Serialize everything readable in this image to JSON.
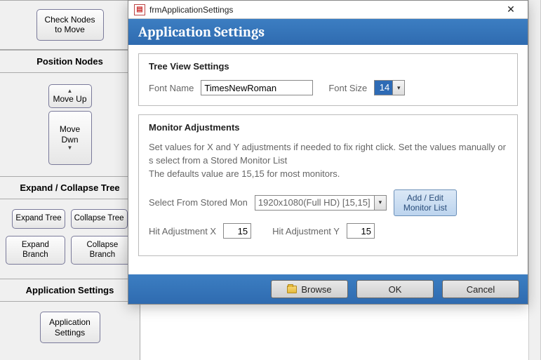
{
  "leftPanel": {
    "checkNodes": "Check Nodes\nto Move",
    "positionHeader": "Position Nodes",
    "moveUp": "Move Up",
    "moveDn": "Move\nDwn",
    "expandHeader": "Expand / Collapse Tree",
    "expandTree": "Expand Tree",
    "collapseTree": "Collapse Tree",
    "expandBranch": "Expand Branch",
    "collapseBranch": "Collapse Branch",
    "appSettingsHeader": "Application Settings",
    "appSettingsBtn": "Application\nSettings"
  },
  "dialog": {
    "formName": "frmApplicationSettings",
    "bannerTitle": "Application Settings",
    "treeView": {
      "title": "Tree View Settings",
      "fontNameLabel": "Font Name",
      "fontNameValue": "TimesNewRoman",
      "fontSizeLabel": "Font Size",
      "fontSizeValue": "14"
    },
    "monitor": {
      "title": "Monitor Adjustments",
      "help": "Set  values for X and Y adjustments if needed to fix right click.   Set the values manually or s select from a Stored Monitor List\nThe defaults value are 15,15 for most monitors.",
      "selectLabel": "Select From Stored Mon",
      "selectValue": "1920x1080(Full HD) [15,15]",
      "addEdit": "Add / Edit\nMonitor List",
      "hitXLabel": "Hit Adjustment X",
      "hitXValue": "15",
      "hitYLabel": "Hit Adjustment Y",
      "hitYValue": "15"
    },
    "footer": {
      "browse": "Browse",
      "ok": "OK",
      "cancel": "Cancel"
    }
  }
}
